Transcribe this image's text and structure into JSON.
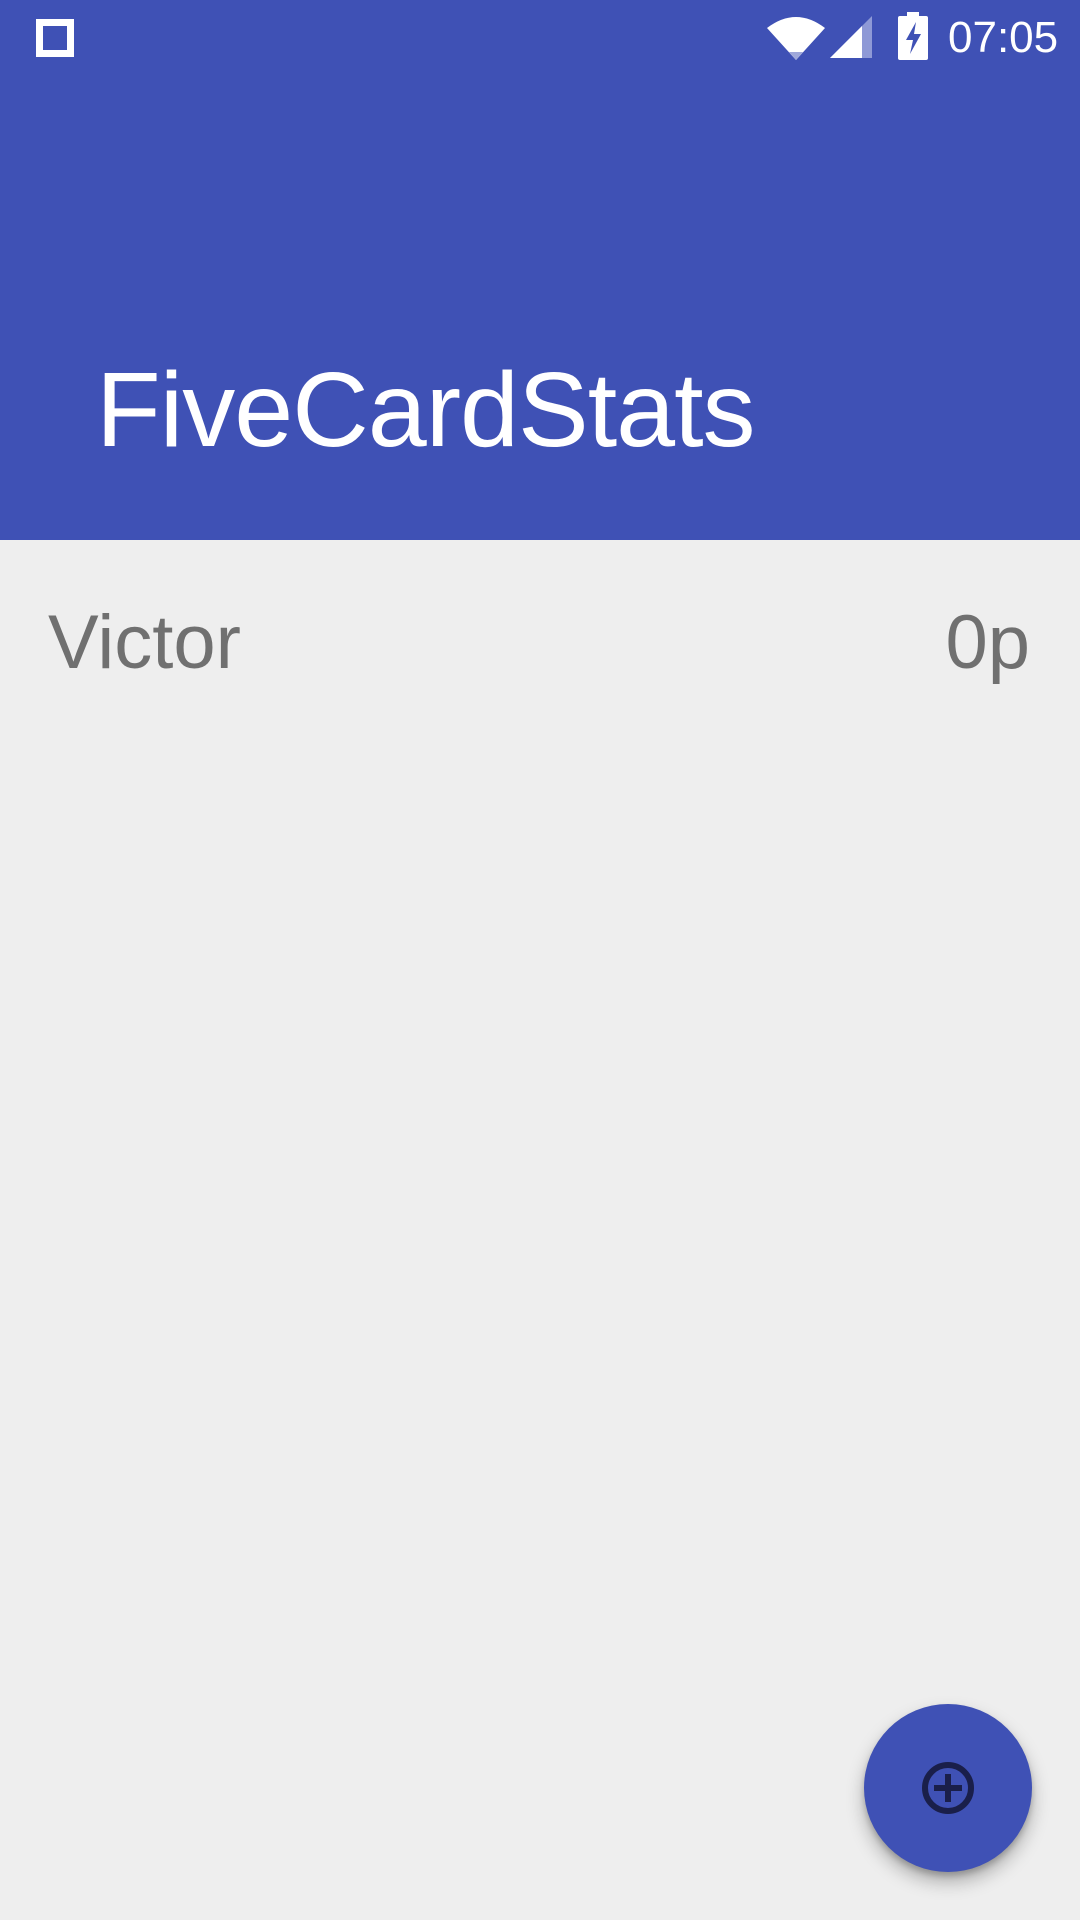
{
  "status_bar": {
    "left_icon": "square-notification-icon",
    "wifi_icon": "wifi-icon",
    "signal_icon": "cell-signal-icon",
    "battery_icon": "battery-charging-icon",
    "time": "07:05"
  },
  "header": {
    "title": "FiveCardStats",
    "color": "#3f51b5"
  },
  "players": [
    {
      "name": "Victor",
      "score": "0p"
    }
  ],
  "fab": {
    "icon": "add-circle-icon",
    "color": "#3f51b5"
  }
}
